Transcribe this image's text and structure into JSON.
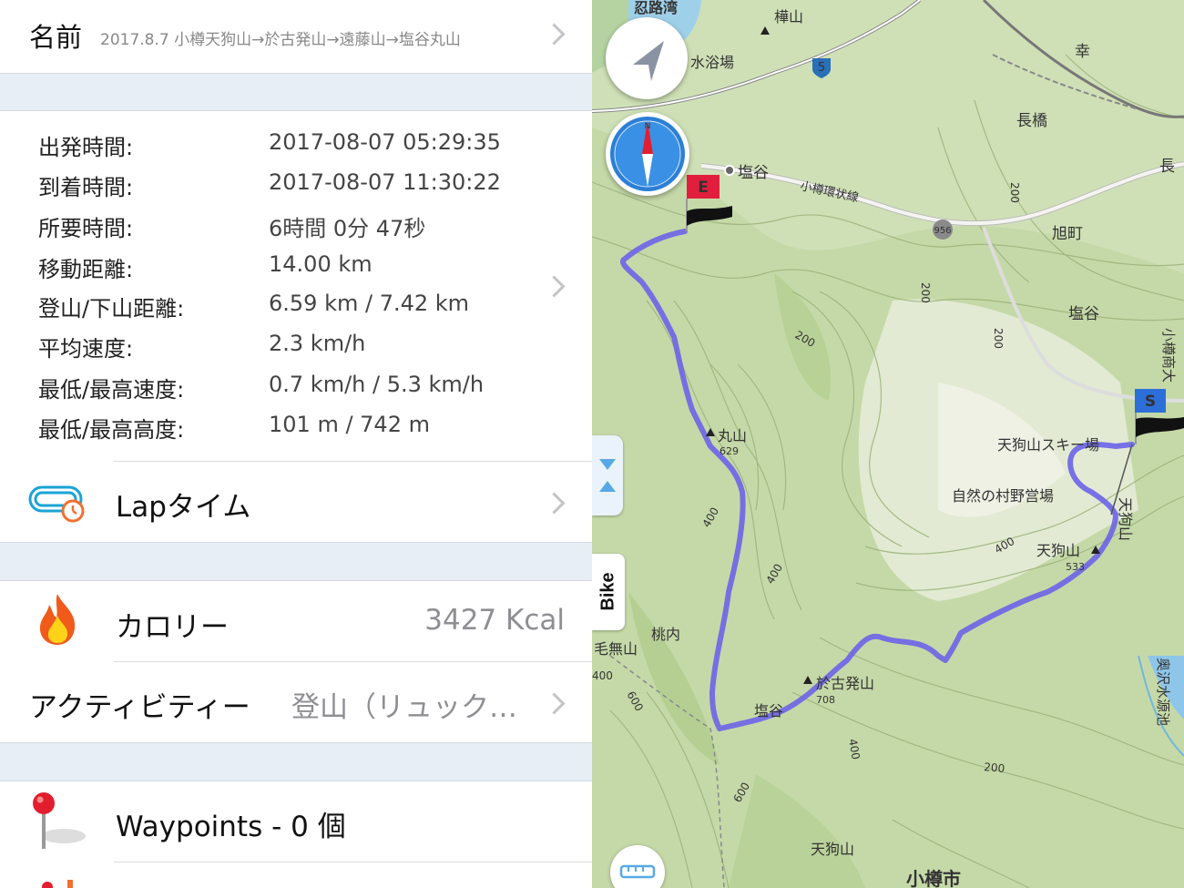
{
  "name_row": {
    "label": "名前",
    "value": "2017.8.7 小樽天狗山→於古発山→遠藤山→塩谷丸山"
  },
  "stats": [
    {
      "label": "出発時間:",
      "value": "2017-08-07 05:29:35"
    },
    {
      "label": "到着時間:",
      "value": "2017-08-07 11:30:22"
    },
    {
      "label": "所要時間:",
      "value": "6時間 0分 47秒"
    },
    {
      "label": "移動距離:",
      "value": "14.00 km"
    },
    {
      "label": "登山/下山距離:",
      "value": "6.59 km / 7.42 km"
    },
    {
      "label": "平均速度:",
      "value": "2.3 km/h"
    },
    {
      "label": "最低/最高速度:",
      "value": "0.7 km/h / 5.3 km/h"
    },
    {
      "label": "最低/最高高度:",
      "value": "101 m / 742 m"
    }
  ],
  "lap": {
    "label": "Lapタイム",
    "icon": "lap-timer-icon"
  },
  "calorie": {
    "label": "カロリー",
    "value": "3427 Kcal",
    "icon": "flame-icon"
  },
  "activity": {
    "label": "アクティビティー",
    "value": "登山（リュック…"
  },
  "waypoints": {
    "label": "Waypoints - 0 個",
    "icon": "pin-icon"
  },
  "map": {
    "bike_tab": "Bike",
    "start_flag": "S",
    "end_flag": "E",
    "route_color": "#6c63e8",
    "peaks": [
      {
        "name": "丸山",
        "elev": "629"
      },
      {
        "name": "於古発山",
        "elev": "708"
      },
      {
        "name": "天狗山",
        "elev": "533"
      },
      {
        "name": "樺山",
        "elev": ""
      }
    ],
    "places": [
      "忍路湾",
      "水浴場",
      "塩谷",
      "小樽環状線",
      "幸",
      "長橋",
      "長",
      "旭町",
      "塩谷",
      "小樽商大",
      "天狗山スキー場",
      "自然の村野営場",
      "天狗山",
      "桃内",
      "毛無山",
      "塩谷",
      "奥沢水源池",
      "天狗山",
      "小樽市"
    ],
    "contours": [
      "200",
      "200",
      "200",
      "200",
      "400",
      "400",
      "400",
      "600",
      "600",
      "400",
      "200",
      "400"
    ],
    "road_shields": [
      "5",
      "956"
    ]
  }
}
